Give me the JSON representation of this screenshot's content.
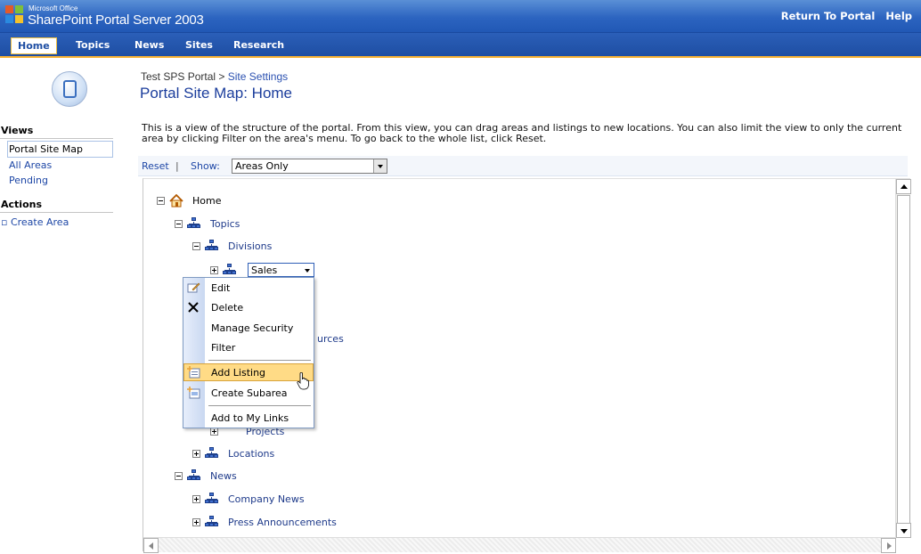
{
  "header": {
    "brand_small": "Microsoft Office",
    "brand_big": "SharePoint Portal Server 2003",
    "links": [
      "Return To Portal",
      "Help"
    ]
  },
  "nav": {
    "tabs": [
      "Home",
      "Topics",
      "News",
      "Sites",
      "Research"
    ],
    "active": "Home"
  },
  "page": {
    "breadcrumb_root": "Test SPS Portal",
    "breadcrumb_sep": ">",
    "breadcrumb_link": "Site Settings",
    "title": "Portal Site Map: Home",
    "description": "This is a view of the structure of the portal. From this view, you can drag areas and listings to new locations. You can also limit the view to only the current area by clicking Filter on the area's menu. To go back to the whole list, click Reset."
  },
  "leftnav": {
    "views_heading": "Views",
    "views": [
      "Portal Site Map",
      "All Areas",
      "Pending"
    ],
    "selected_view": "Portal Site Map",
    "actions_heading": "Actions",
    "actions": [
      "Create Area"
    ]
  },
  "filterbar": {
    "reset": "Reset",
    "sep": "|",
    "show": "Show:",
    "show_value": "Areas Only"
  },
  "tree": {
    "home": "Home",
    "topics": "Topics",
    "divisions": "Divisions",
    "sales": "Sales",
    "partial_resources": "urces",
    "projects": "Projects",
    "locations": "Locations",
    "news": "News",
    "company_news": "Company News",
    "press": "Press Announcements"
  },
  "context_menu": {
    "items": [
      "Edit",
      "Delete",
      "Manage Security",
      "Filter",
      "Add Listing",
      "Create Subarea",
      "Add to My Links"
    ],
    "highlighted": "Add Listing"
  },
  "colors": {
    "header_blue": "#2c64c0",
    "nav_accent": "#f9b233",
    "link_blue": "#1e47a6",
    "menu_highlight": "#ffdb86"
  }
}
